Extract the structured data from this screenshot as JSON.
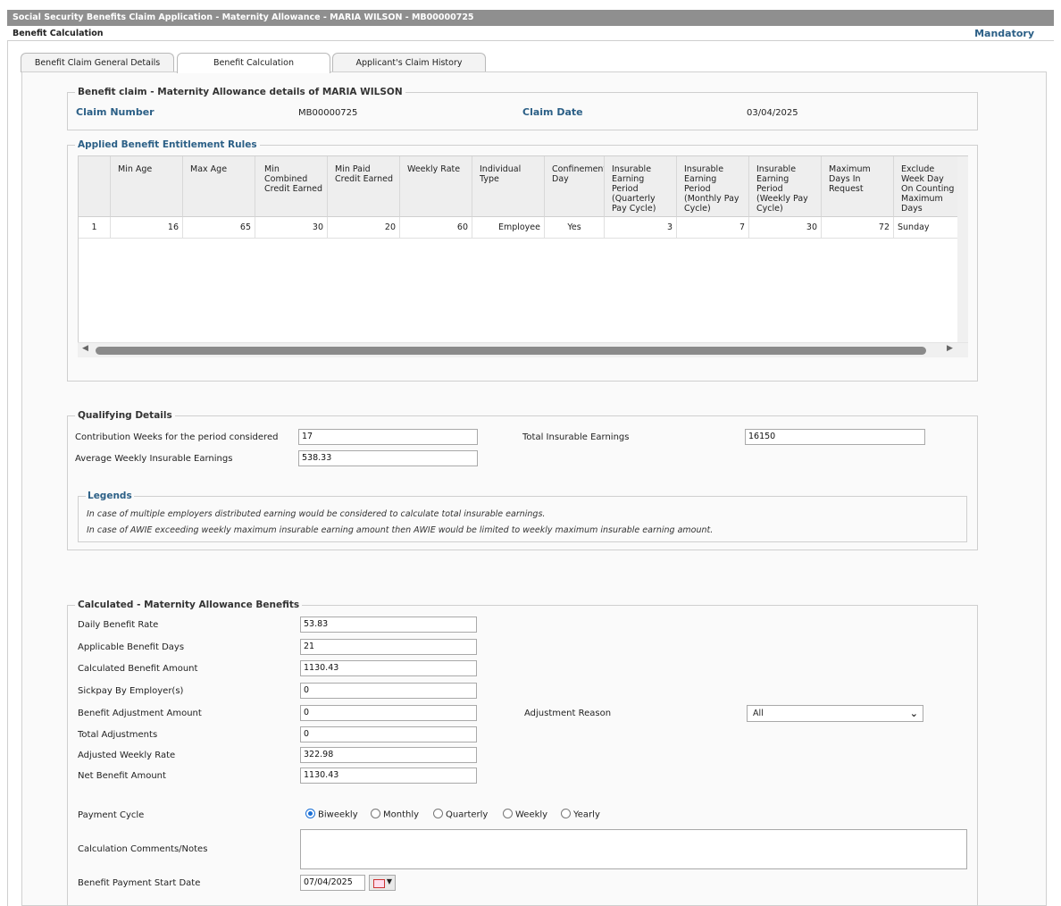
{
  "window": {
    "title": "Social Security Benefits Claim Application - Maternity Allowance - MARIA WILSON - MB00000725",
    "section": "Benefit Calculation",
    "mandatory": "Mandatory"
  },
  "tabs": [
    {
      "label": "Benefit Claim General Details",
      "active": false
    },
    {
      "label": "Benefit Calculation",
      "active": true
    },
    {
      "label": "Applicant's Claim History",
      "active": false
    }
  ],
  "claim": {
    "legend": "Benefit claim - Maternity Allowance details of MARIA WILSON",
    "number_label": "Claim Number",
    "number_value": "MB00000725",
    "date_label": "Claim Date",
    "date_value": "03/04/2025"
  },
  "rules": {
    "legend": "Applied Benefit Entitlement Rules",
    "columns": [
      "",
      "Min Age",
      "Max Age",
      "Min Combined Credit Earned",
      "Min Paid Credit Earned",
      "Weekly Rate",
      "Individual Type",
      "Confinement Day",
      "Insurable Earning Period (Quarterly Pay Cycle)",
      "Insurable Earning Period (Monthly Pay Cycle)",
      "Insurable Earning Period (Weekly Pay Cycle)",
      "Maximum Days In Request",
      "Exclude Week Day On Counting Maximum Days"
    ],
    "rows": [
      [
        "1",
        "16",
        "65",
        "30",
        "20",
        "60",
        "Employee",
        "Yes",
        "3",
        "7",
        "30",
        "72",
        "Sunday"
      ]
    ]
  },
  "qualifying": {
    "legend": "Qualifying Details",
    "contribution_weeks_label": "Contribution Weeks for the period considered",
    "contribution_weeks_value": "17",
    "total_insurable_label": "Total Insurable Earnings",
    "total_insurable_value": "16150",
    "awie_label": "Average Weekly Insurable Earnings",
    "awie_value": "538.33",
    "legends_title": "Legends",
    "legend_note_1": "In case of multiple employers distributed earning would be considered to calculate total insurable earnings.",
    "legend_note_2": "In case of AWIE exceeding weekly maximum insurable earning amount then AWIE would be limited to weekly maximum insurable earning amount."
  },
  "calculated": {
    "legend": "Calculated - Maternity Allowance Benefits",
    "fields": [
      {
        "label": "Daily Benefit Rate",
        "value": "53.83"
      },
      {
        "label": "Applicable Benefit Days",
        "value": "21"
      },
      {
        "label": "Calculated Benefit Amount",
        "value": "1130.43"
      },
      {
        "label": "Sickpay By Employer(s)",
        "value": "0"
      },
      {
        "label": "Benefit Adjustment Amount",
        "value": "0"
      },
      {
        "label": "Total Adjustments",
        "value": "0"
      },
      {
        "label": "Adjusted Weekly Rate",
        "value": "322.98"
      },
      {
        "label": "Net Benefit Amount",
        "value": "1130.43"
      }
    ],
    "adjustment_reason_label": "Adjustment Reason",
    "adjustment_reason_value": "All",
    "payment_cycle_label": "Payment Cycle",
    "payment_cycle_options": [
      "Biweekly",
      "Monthly",
      "Quarterly",
      "Weekly",
      "Yearly"
    ],
    "payment_cycle_selected": "Biweekly",
    "comments_label": "Calculation Comments/Notes",
    "start_date_label": "Benefit Payment Start Date",
    "start_date_value": "07/04/2025"
  }
}
